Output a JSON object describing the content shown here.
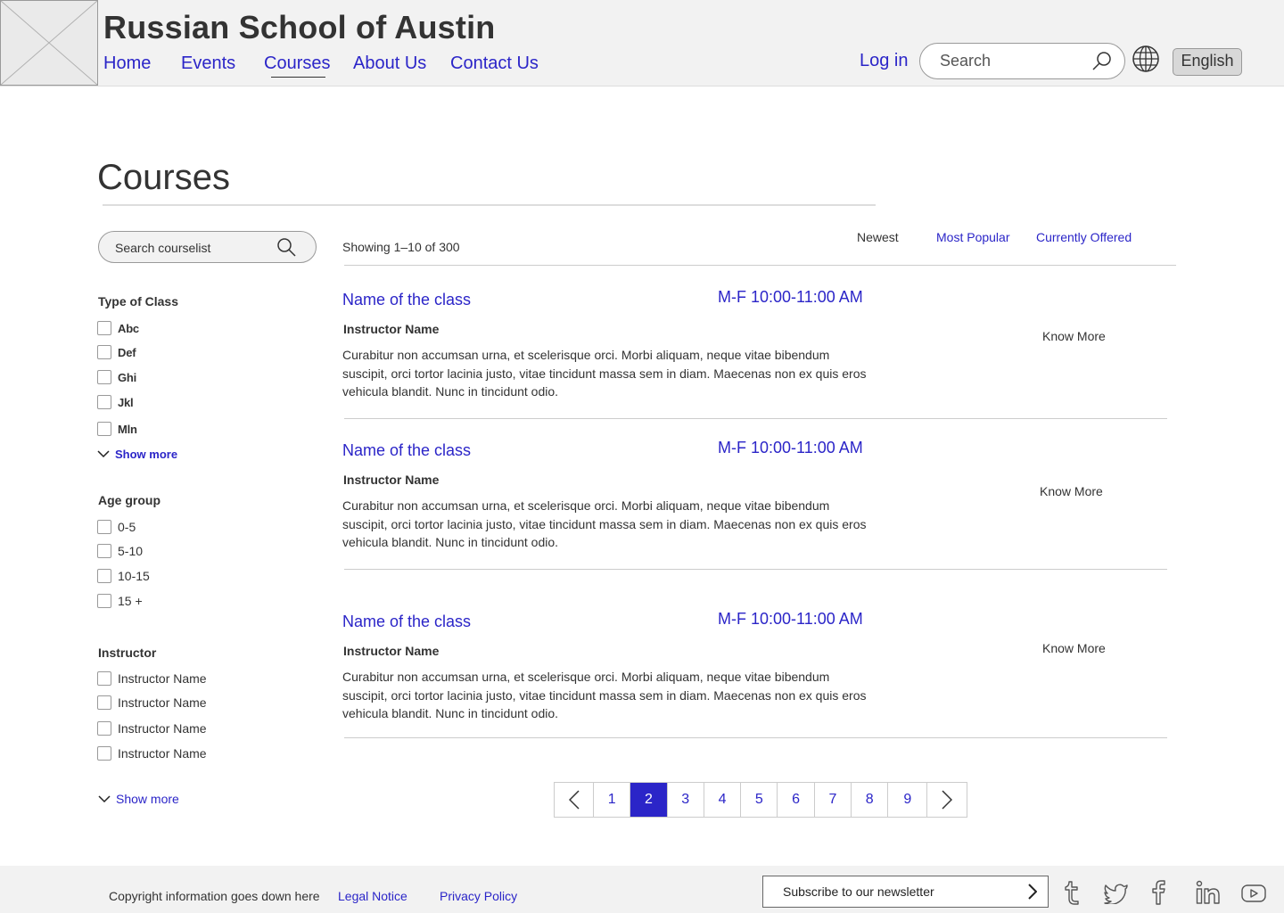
{
  "site": {
    "title": "Russian School of Austin"
  },
  "nav": {
    "items": [
      "Home",
      "Events",
      "Courses",
      "About Us",
      "Contact Us"
    ]
  },
  "header": {
    "login": "Log in",
    "search_placeholder": "Search",
    "language": "English"
  },
  "colors": {
    "accent": "#2b25c8",
    "header_bg": "#f2f2f2",
    "text": "#333333"
  },
  "page": {
    "title": "Courses"
  },
  "sidebar": {
    "search_placeholder": "Search courselist",
    "type_heading": "Type of  Class",
    "types": [
      "Abc",
      "Def",
      "Ghi",
      "Jkl",
      "Mln"
    ],
    "type_show_more": "Show more",
    "age_heading": "Age group",
    "ages": [
      "0-5",
      "5-10",
      "10-15",
      "15 +"
    ],
    "instructor_heading": "Instructor",
    "instructors": [
      "Instructor Name",
      "Instructor Name",
      "Instructor Name",
      "Instructor Name"
    ],
    "instructor_show_more": "Show more"
  },
  "listing": {
    "showing": "Showing 1–10 of 300",
    "sort_tabs": [
      "Newest",
      "Most Popular",
      "Currently Offered"
    ],
    "courses": [
      {
        "name": "Name of the class",
        "time": "M-F 10:00-11:00 AM",
        "instructor": "Instructor Name",
        "description": "Curabitur non accumsan urna, et scelerisque orci. Morbi aliquam, neque vitae bibendum suscipit, orci tortor lacinia justo, vitae tincidunt massa sem in diam. Maecenas non ex quis eros vehicula blandit. Nunc in tincidunt odio.",
        "cta": "Know More"
      },
      {
        "name": "Name of the class",
        "time": "M-F 10:00-11:00 AM",
        "instructor": "Instructor Name",
        "description": "Curabitur non accumsan urna, et scelerisque orci. Morbi aliquam, neque vitae bibendum suscipit, orci tortor lacinia justo, vitae tincidunt massa sem in diam. Maecenas non ex quis eros vehicula blandit. Nunc in tincidunt odio.",
        "cta": "Know More"
      },
      {
        "name": "Name of the class",
        "time": "M-F 10:00-11:00 AM",
        "instructor": "Instructor Name",
        "description": "Curabitur non accumsan urna, et scelerisque orci. Morbi aliquam, neque vitae bibendum suscipit, orci tortor lacinia justo, vitae tincidunt massa sem in diam. Maecenas non ex quis eros vehicula blandit. Nunc in tincidunt odio.",
        "cta": "Know More"
      }
    ]
  },
  "pagination": {
    "pages": [
      "1",
      "2",
      "3",
      "4",
      "5",
      "6",
      "7",
      "8",
      "9"
    ],
    "current": "2"
  },
  "footer": {
    "copyright": "Copyright information goes down here",
    "legal": "Legal Notice",
    "privacy": "Privacy Policy",
    "newsletter": "Subscribe to our newsletter",
    "social_icons": [
      "tumblr-icon",
      "twitter-icon",
      "facebook-icon",
      "linkedin-icon",
      "youtube-icon"
    ]
  }
}
